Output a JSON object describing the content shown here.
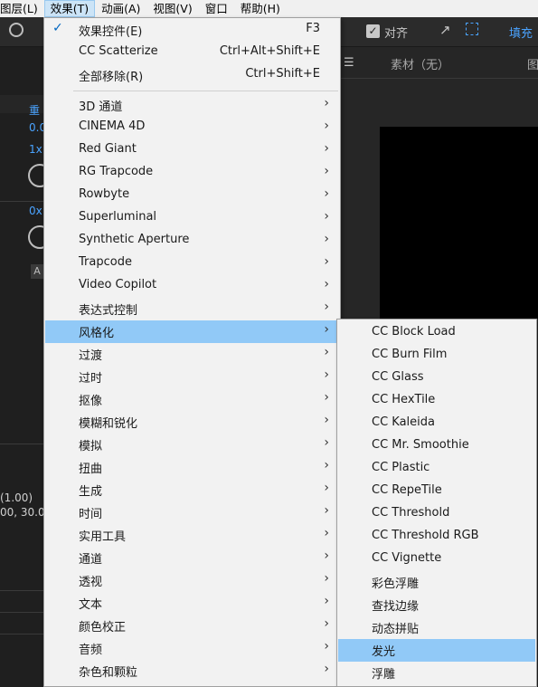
{
  "menubar": {
    "items": [
      "图层(L)",
      "效果(T)",
      "动画(A)",
      "视图(V)",
      "窗口",
      "帮助(H)"
    ],
    "active_index": 1
  },
  "toolbar": {
    "align_label": "对齐",
    "fill_label": "填充"
  },
  "left_panel": {
    "label_reset": "重",
    "value_1": "0.0",
    "value_2": "1x",
    "value_3": "0x",
    "button_label": "A",
    "value_4": "(1.00)",
    "value_5": "00, 30.0"
  },
  "right_panel": {
    "source_label": "素材（无）",
    "tab_partial": "图"
  },
  "effect_menu": {
    "items": [
      {
        "label": "效果控件(E)",
        "shortcut": "F3",
        "checked": true
      },
      {
        "label": "CC Scatterize",
        "shortcut": "Ctrl+Alt+Shift+E"
      },
      {
        "label": "全部移除(R)",
        "shortcut": "Ctrl+Shift+E"
      },
      {
        "label": "3D 通道",
        "submenu": true
      },
      {
        "label": "CINEMA 4D",
        "submenu": true
      },
      {
        "label": "Red Giant",
        "submenu": true
      },
      {
        "label": "RG Trapcode",
        "submenu": true
      },
      {
        "label": "Rowbyte",
        "submenu": true
      },
      {
        "label": "Superluminal",
        "submenu": true
      },
      {
        "label": "Synthetic Aperture",
        "submenu": true
      },
      {
        "label": "Trapcode",
        "submenu": true
      },
      {
        "label": "Video Copilot",
        "submenu": true
      },
      {
        "label": "表达式控制",
        "submenu": true
      },
      {
        "label": "风格化",
        "submenu": true,
        "highlighted": true
      },
      {
        "label": "过渡",
        "submenu": true
      },
      {
        "label": "过时",
        "submenu": true
      },
      {
        "label": "抠像",
        "submenu": true
      },
      {
        "label": "模糊和锐化",
        "submenu": true
      },
      {
        "label": "模拟",
        "submenu": true
      },
      {
        "label": "扭曲",
        "submenu": true
      },
      {
        "label": "生成",
        "submenu": true
      },
      {
        "label": "时间",
        "submenu": true
      },
      {
        "label": "实用工具",
        "submenu": true
      },
      {
        "label": "通道",
        "submenu": true
      },
      {
        "label": "透视",
        "submenu": true
      },
      {
        "label": "文本",
        "submenu": true
      },
      {
        "label": "颜色校正",
        "submenu": true
      },
      {
        "label": "音频",
        "submenu": true
      },
      {
        "label": "杂色和颗粒",
        "submenu": true
      }
    ]
  },
  "stylize_submenu": {
    "items": [
      {
        "label": "CC Block Load"
      },
      {
        "label": "CC Burn Film"
      },
      {
        "label": "CC Glass"
      },
      {
        "label": "CC HexTile"
      },
      {
        "label": "CC Kaleida"
      },
      {
        "label": "CC Mr. Smoothie"
      },
      {
        "label": "CC Plastic"
      },
      {
        "label": "CC RepeTile"
      },
      {
        "label": "CC Threshold"
      },
      {
        "label": "CC Threshold RGB"
      },
      {
        "label": "CC Vignette"
      },
      {
        "label": "彩色浮雕"
      },
      {
        "label": "查找边缘"
      },
      {
        "label": "动态拼贴"
      },
      {
        "label": "发光",
        "highlighted": true
      },
      {
        "label": "浮雕"
      }
    ]
  },
  "colors": {
    "highlight": "#91c9f7",
    "menu_bg": "#f2f2f2",
    "accent_blue": "#4aa3ff",
    "app_bg": "#232323"
  }
}
